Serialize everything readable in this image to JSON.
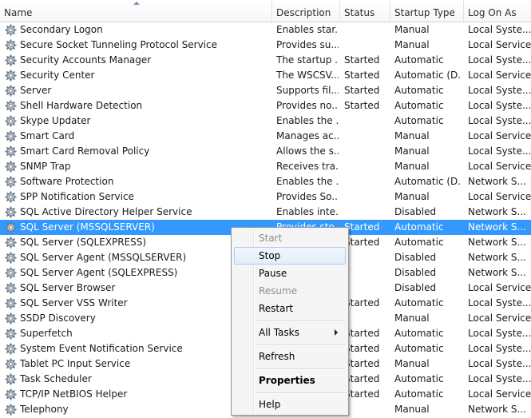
{
  "columns": {
    "name": "Name",
    "description": "Description",
    "status": "Status",
    "startup_type": "Startup Type",
    "log_on_as": "Log On As",
    "sorted_column": "Name",
    "sort_direction": "ascending"
  },
  "services": [
    {
      "name": "Secondary Logon",
      "description": "Enables star...",
      "status": "",
      "startup": "Manual",
      "logon": "Local Syste..."
    },
    {
      "name": "Secure Socket Tunneling Protocol Service",
      "description": "Provides su...",
      "status": "",
      "startup": "Manual",
      "logon": "Local Service"
    },
    {
      "name": "Security Accounts Manager",
      "description": "The startup ...",
      "status": "Started",
      "startup": "Automatic",
      "logon": "Local Syste..."
    },
    {
      "name": "Security Center",
      "description": "The WSCSV...",
      "status": "Started",
      "startup": "Automatic (D...",
      "logon": "Local Service"
    },
    {
      "name": "Server",
      "description": "Supports fil...",
      "status": "Started",
      "startup": "Automatic",
      "logon": "Local Syste..."
    },
    {
      "name": "Shell Hardware Detection",
      "description": "Provides no...",
      "status": "Started",
      "startup": "Automatic",
      "logon": "Local Syste..."
    },
    {
      "name": "Skype Updater",
      "description": "Enables the ...",
      "status": "",
      "startup": "Automatic",
      "logon": "Local Syste..."
    },
    {
      "name": "Smart Card",
      "description": "Manages ac...",
      "status": "",
      "startup": "Manual",
      "logon": "Local Service"
    },
    {
      "name": "Smart Card Removal Policy",
      "description": "Allows the s...",
      "status": "",
      "startup": "Manual",
      "logon": "Local Syste..."
    },
    {
      "name": "SNMP Trap",
      "description": "Receives tra...",
      "status": "",
      "startup": "Manual",
      "logon": "Local Service"
    },
    {
      "name": "Software Protection",
      "description": "Enables the ...",
      "status": "",
      "startup": "Automatic (D...",
      "logon": "Network S..."
    },
    {
      "name": "SPP Notification Service",
      "description": "Provides So...",
      "status": "",
      "startup": "Manual",
      "logon": "Local Service"
    },
    {
      "name": "SQL Active Directory Helper Service",
      "description": "Enables inte...",
      "status": "",
      "startup": "Disabled",
      "logon": "Network S..."
    },
    {
      "name": "SQL Server (MSSQLSERVER)",
      "description": "Provides sto...",
      "status": "Started",
      "startup": "Automatic",
      "logon": "Network S...",
      "selected": true
    },
    {
      "name": "SQL Server (SQLEXPRESS)",
      "description": "",
      "status": "Started",
      "startup": "Automatic",
      "logon": "Network S..."
    },
    {
      "name": "SQL Server Agent (MSSQLSERVER)",
      "description": "",
      "status": "",
      "startup": "Disabled",
      "logon": "Network S..."
    },
    {
      "name": "SQL Server Agent (SQLEXPRESS)",
      "description": "",
      "status": "",
      "startup": "Disabled",
      "logon": "Network S..."
    },
    {
      "name": "SQL Server Browser",
      "description": "",
      "status": "",
      "startup": "Disabled",
      "logon": "Local Service"
    },
    {
      "name": "SQL Server VSS Writer",
      "description": "",
      "status": "Started",
      "startup": "Automatic",
      "logon": "Local Syste..."
    },
    {
      "name": "SSDP Discovery",
      "description": "",
      "status": "",
      "startup": "Manual",
      "logon": "Local Service"
    },
    {
      "name": "Superfetch",
      "description": "",
      "status": "Started",
      "startup": "Automatic",
      "logon": "Local Syste..."
    },
    {
      "name": "System Event Notification Service",
      "description": "",
      "status": "Started",
      "startup": "Automatic",
      "logon": "Local Syste..."
    },
    {
      "name": "Tablet PC Input Service",
      "description": "",
      "status": "Started",
      "startup": "Manual",
      "logon": "Local Syste..."
    },
    {
      "name": "Task Scheduler",
      "description": "",
      "status": "Started",
      "startup": "Automatic",
      "logon": "Local Syste..."
    },
    {
      "name": "TCP/IP NetBIOS Helper",
      "description": "",
      "status": "Started",
      "startup": "Automatic",
      "logon": "Local Service"
    },
    {
      "name": "Telephony",
      "description": "",
      "status": "",
      "startup": "Manual",
      "logon": "Network S..."
    }
  ],
  "context_menu": {
    "items": [
      {
        "label": "Start",
        "state": "disabled"
      },
      {
        "label": "Stop",
        "state": "hover"
      },
      {
        "label": "Pause",
        "state": "enabled"
      },
      {
        "label": "Resume",
        "state": "disabled"
      },
      {
        "label": "Restart",
        "state": "enabled"
      },
      {
        "label": "All Tasks",
        "state": "enabled",
        "submenu": true
      },
      {
        "label": "Refresh",
        "state": "enabled"
      },
      {
        "label": "Properties",
        "state": "enabled",
        "bold": true
      },
      {
        "label": "Help",
        "state": "enabled"
      }
    ]
  },
  "colors": {
    "selection": "#3399ff",
    "menu_hover_border": "#aecbee"
  },
  "icons": {
    "service": "gear-icon",
    "submenu": "submenu-arrow-icon",
    "sort": "sort-ascending-icon"
  }
}
